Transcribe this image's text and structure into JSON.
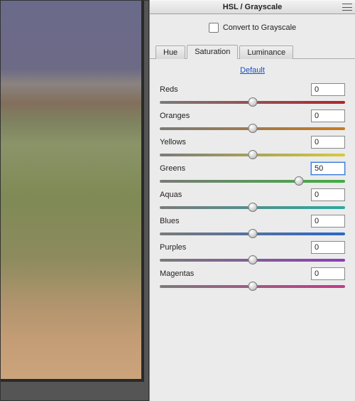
{
  "panel": {
    "title": "HSL / Grayscale",
    "convert_label": "Convert to Grayscale",
    "tabs": {
      "hue": "Hue",
      "saturation": "Saturation",
      "luminance": "Luminance",
      "active": "saturation"
    },
    "default_label": "Default",
    "sliders": [
      {
        "label": "Reds",
        "value": "0",
        "pos": 50,
        "gradient": [
          "#7a7a7a",
          "#b02628"
        ]
      },
      {
        "label": "Oranges",
        "value": "0",
        "pos": 50,
        "gradient": [
          "#7a7a7a",
          "#c87a1e"
        ]
      },
      {
        "label": "Yellows",
        "value": "0",
        "pos": 50,
        "gradient": [
          "#7a7a7a",
          "#d6cc3a"
        ]
      },
      {
        "label": "Greens",
        "value": "50",
        "pos": 75,
        "gradient": [
          "#7a7a7a",
          "#3fae3f"
        ],
        "focus": true
      },
      {
        "label": "Aquas",
        "value": "0",
        "pos": 50,
        "gradient": [
          "#7a7a7a",
          "#2aa9a0"
        ]
      },
      {
        "label": "Blues",
        "value": "0",
        "pos": 50,
        "gradient": [
          "#7a7a7a",
          "#2a67c9"
        ]
      },
      {
        "label": "Purples",
        "value": "0",
        "pos": 50,
        "gradient": [
          "#7a7a7a",
          "#8a3fb5"
        ]
      },
      {
        "label": "Magentas",
        "value": "0",
        "pos": 50,
        "gradient": [
          "#7a7a7a",
          "#c23a8a"
        ]
      }
    ]
  }
}
